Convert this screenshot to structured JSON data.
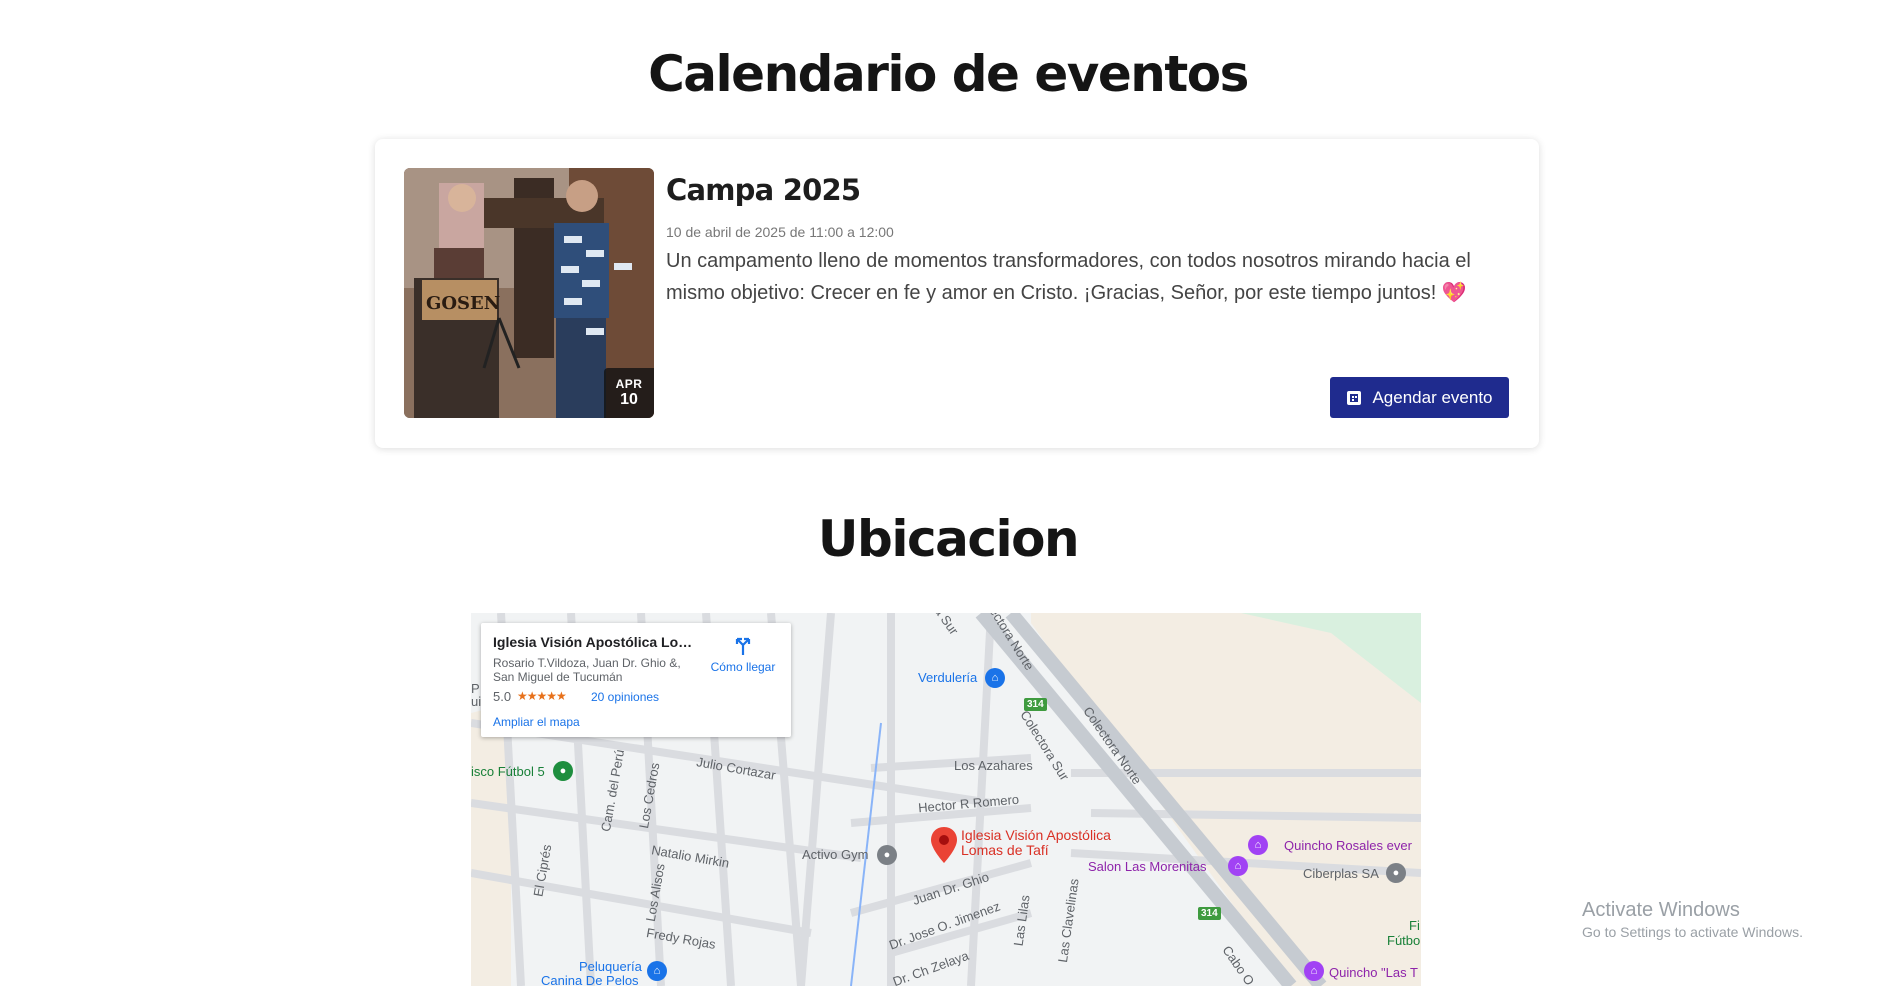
{
  "events_section": {
    "title": "Calendario de eventos",
    "event": {
      "title": "Campa 2025",
      "datetime": "10 de abril de 2025 de 11:00 a 12:00",
      "description": "Un campamento lleno de momentos transformadores, con todos nosotros mirando hacia el mismo objetivo: Crecer en fe y amor en Cristo. ¡Gracias, Señor, por este tiempo juntos!",
      "emoji": "💖",
      "badge_month": "APR",
      "badge_day": "10",
      "image_sign_text": "GOSEN",
      "button_label": "Agendar evento",
      "button_color": "#1f2b8e"
    }
  },
  "location_section": {
    "title": "Ubicacion",
    "map": {
      "place_name": "Iglesia Visión Apostólica Lom...",
      "address_line1": "Rosario T.Vildoza, Juan Dr. Ghio &,",
      "address_line2": "San Miguel de Tucumán",
      "rating": "5.0",
      "stars": "★★★★★",
      "reviews": "20 opiniones",
      "directions_label": "Cómo llegar",
      "enlarge_label": "Ampliar el mapa",
      "pin_label_line1": "Iglesia Visión Apostólica",
      "pin_label_line2": "Lomas de Tafí",
      "labels": {
        "verduleria": "Verdulería",
        "futbol": "isco Fútbol 5",
        "p_label": "P",
        "ui_label": "ui",
        "julio_cortazar": "Julio Cortazar",
        "los_azahares": "Los Azahares",
        "hector_romero": "Hector R Romero",
        "colectora_sur": "Colectora Sur",
        "colectora_norte": "Colectora Norte",
        "colectora_norte_top": "ectora Norte",
        "sur_top": "a Sur",
        "cam_peru": "Cam. del Perú",
        "los_cedros": "Los Cedros",
        "natalio_mirkin": "Natalio Mirkin",
        "activo_gym": "Activo Gym",
        "el_cipres": "El Ciprés",
        "los_alisos": "Los Alisos",
        "juan_ghio": "Juan Dr. Ghio",
        "jose_jimenez": "Dr. Jose O. Jimenez",
        "ch_zelaya": "Dr. Ch Zelaya",
        "fredy_rojas": "Fredy Rojas",
        "peluqueria": "Peluquería",
        "canina": "Canina De Pelos",
        "salon_morenitas": "Salon Las Morenitas",
        "quincho_rosales": "Quincho Rosales ever",
        "ciberplas": "Ciberplas SA",
        "las_lilas": "Las Lilas",
        "las_clavelinas": "Las Clavelinas",
        "cabo": "Cabo O",
        "quincho_las": "Quincho \"Las T",
        "fi": "Fi",
        "futbol_right": "Fútbo",
        "route_314_a": "314",
        "route_314_b": "314"
      }
    }
  },
  "os_overlay": {
    "title": "Activate Windows",
    "subtitle": "Go to Settings to activate Windows."
  }
}
